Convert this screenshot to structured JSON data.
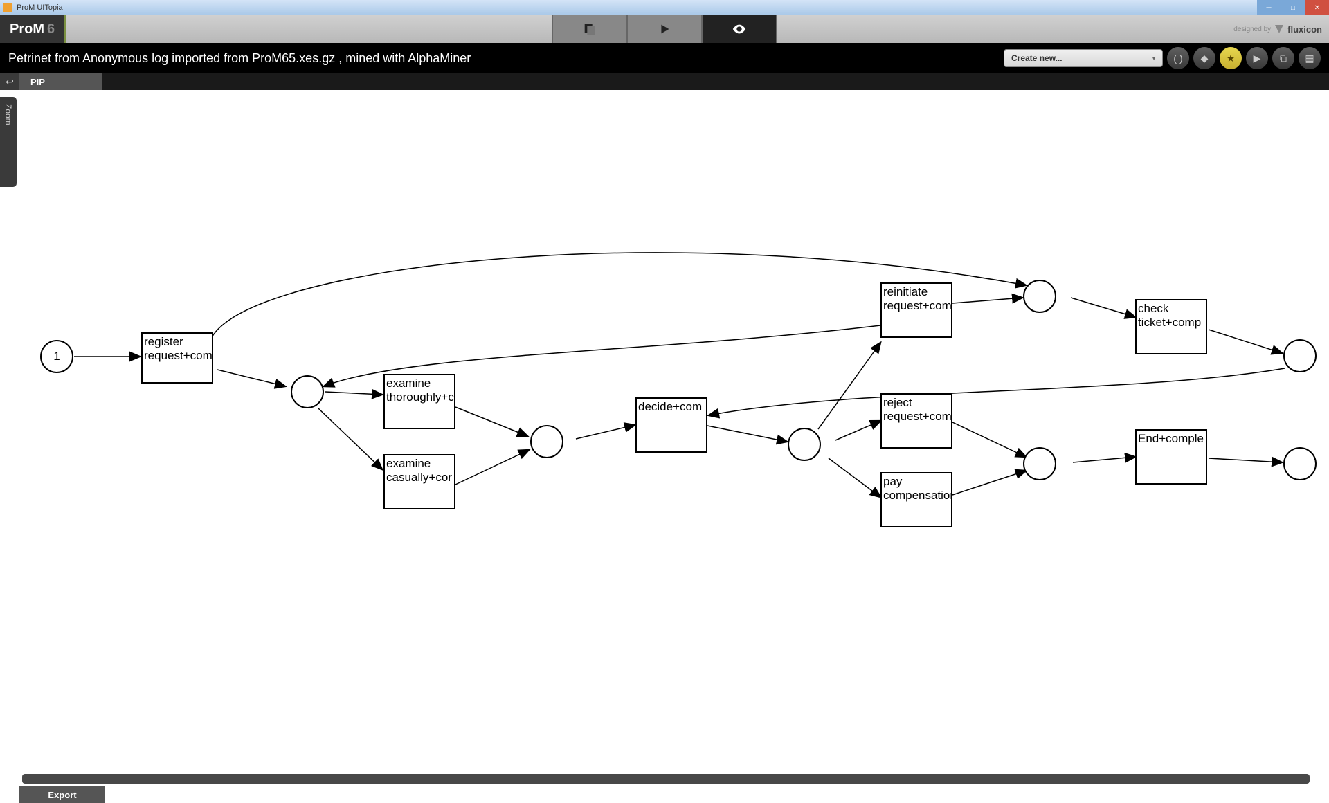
{
  "window": {
    "title": "ProM UITopia"
  },
  "app": {
    "logo_name": "ProM",
    "logo_version": "6",
    "designed_by": "designed by",
    "brand": "fluxicon"
  },
  "subheader": {
    "title": "Petrinet from Anonymous log imported from ProM65.xes.gz , mined with AlphaMiner",
    "create_label": "Create new..."
  },
  "tabs": {
    "pip": "PIP"
  },
  "sidebar": {
    "zoom": "Zoom"
  },
  "footer": {
    "export": "Export"
  },
  "petrinet": {
    "places": {
      "p_start": {
        "label": "1"
      }
    },
    "transitions": {
      "register": "register request+com",
      "examine_thoroughly": "examine thoroughly+c",
      "examine_casually": "examine casually+cor",
      "decide": "decide+com",
      "reinitiate": "reinitiate request+com",
      "reject": "reject request+com",
      "pay": "pay compensation",
      "check_ticket": "check ticket+comp",
      "end": "End+comple"
    }
  }
}
